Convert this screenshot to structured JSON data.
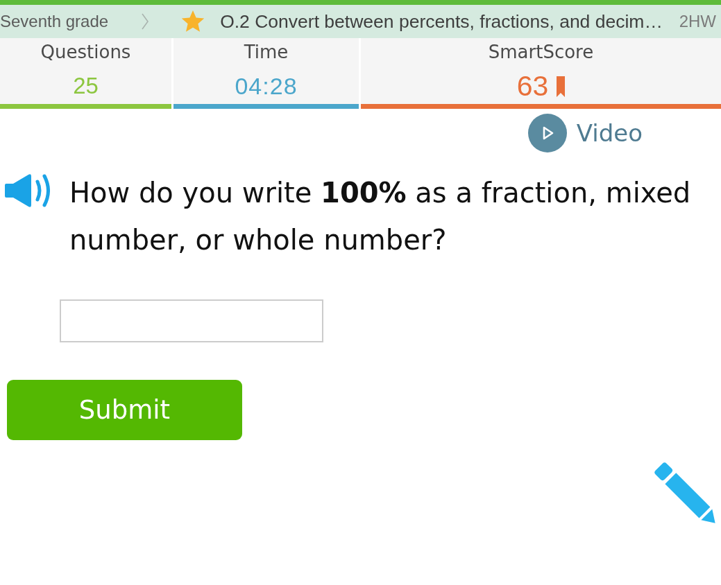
{
  "breadcrumb": {
    "grade": "Seventh grade",
    "skill": "O.2 Convert between percents, fractions, and decim…",
    "assignment": "2HW"
  },
  "stats": [
    {
      "kind": "count",
      "label": "Questions",
      "value": "25",
      "color": "#8cc63f"
    },
    {
      "kind": "timer",
      "label": "Time",
      "value": "04:28",
      "color": "#4ba6cb"
    },
    {
      "kind": "score",
      "label": "SmartScore",
      "value": "63",
      "color": "#e8703a"
    }
  ],
  "video_button": {
    "label": "Video"
  },
  "question": {
    "text": "How do you write **100%** as a fraction, mixed number, or whole number?"
  },
  "submit_button": {
    "label": "Submit"
  }
}
